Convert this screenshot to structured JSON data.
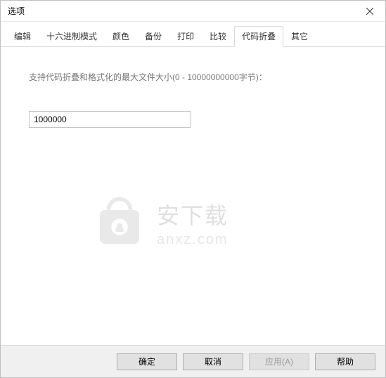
{
  "window": {
    "title": "选项"
  },
  "tabs": [
    {
      "label": "编辑"
    },
    {
      "label": "十六进制模式"
    },
    {
      "label": "颜色"
    },
    {
      "label": "备份"
    },
    {
      "label": "打印"
    },
    {
      "label": "比较"
    },
    {
      "label": "代码折叠",
      "active": true
    },
    {
      "label": "其它"
    }
  ],
  "content": {
    "field_label": "支持代码折叠和格式化的最大文件大小(0 - 10000000000字节)：",
    "input_value": "1000000"
  },
  "watermark": {
    "line1": "安下载",
    "line2": "anxz.com"
  },
  "buttons": {
    "ok": "确定",
    "cancel": "取消",
    "apply": "应用(A)",
    "help": "帮助"
  }
}
